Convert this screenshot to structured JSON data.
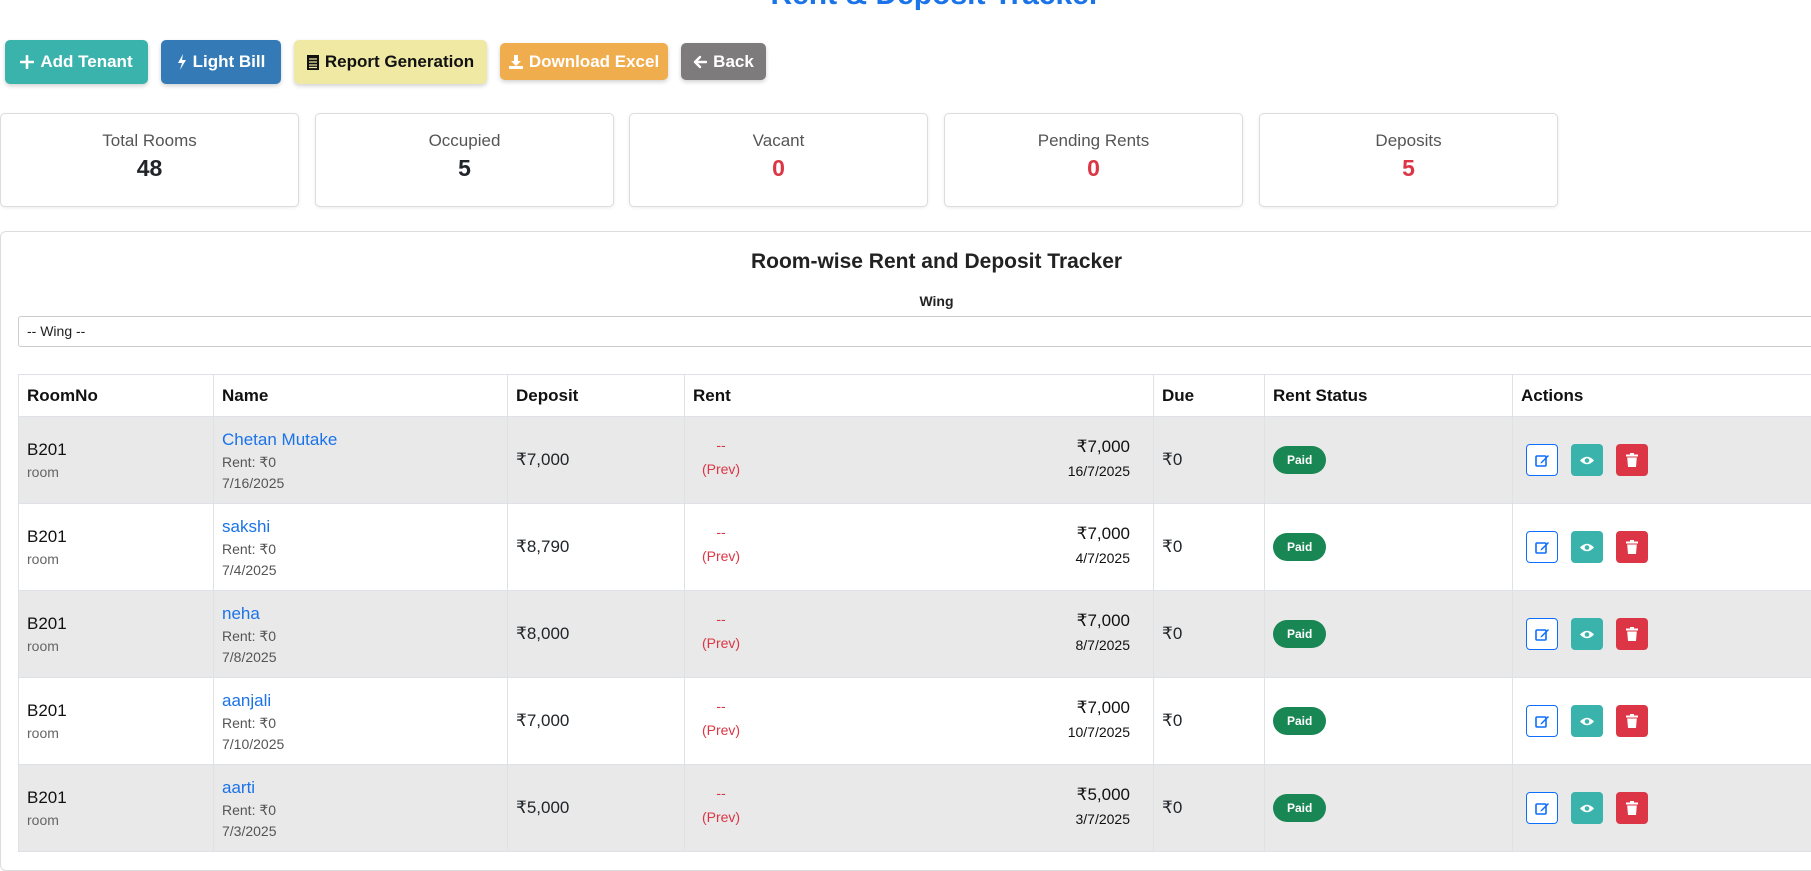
{
  "page": {
    "title": "Rent & Deposit Tracker"
  },
  "toolbar": {
    "add_tenant": "Add Tenant",
    "light_bill": "Light Bill",
    "report_generation": "Report Generation",
    "download_excel": "Download Excel",
    "back": "Back"
  },
  "stats": {
    "total_rooms": {
      "label": "Total Rooms",
      "value": "48"
    },
    "occupied": {
      "label": "Occupied",
      "value": "5"
    },
    "vacant": {
      "label": "Vacant",
      "value": "0"
    },
    "pending_rents": {
      "label": "Pending Rents",
      "value": "0"
    },
    "deposits": {
      "label": "Deposits",
      "value": "5"
    }
  },
  "tracker": {
    "title": "Room-wise Rent and Deposit Tracker",
    "wing_label": "Wing",
    "wing_selected": "-- Wing --",
    "columns": [
      "RoomNo",
      "Name",
      "Deposit",
      "Rent",
      "Due",
      "Rent Status",
      "Actions"
    ],
    "rows": [
      {
        "room": "B201",
        "room_type": "room",
        "name": "Chetan Mutake",
        "rent_line": "Rent: ₹0",
        "date": "7/16/2025",
        "deposit": "₹7,000",
        "prev_dash": "--",
        "prev_label": "(Prev)",
        "rent_amount": "₹7,000",
        "rent_date": "16/7/2025",
        "due": "₹0",
        "status": "Paid"
      },
      {
        "room": "B201",
        "room_type": "room",
        "name": "sakshi",
        "rent_line": "Rent: ₹0",
        "date": "7/4/2025",
        "deposit": "₹8,790",
        "prev_dash": "--",
        "prev_label": "(Prev)",
        "rent_amount": "₹7,000",
        "rent_date": "4/7/2025",
        "due": "₹0",
        "status": "Paid"
      },
      {
        "room": "B201",
        "room_type": "room",
        "name": "neha",
        "rent_line": "Rent: ₹0",
        "date": "7/8/2025",
        "deposit": "₹8,000",
        "prev_dash": "--",
        "prev_label": "(Prev)",
        "rent_amount": "₹7,000",
        "rent_date": "8/7/2025",
        "due": "₹0",
        "status": "Paid"
      },
      {
        "room": "B201",
        "room_type": "room",
        "name": "aanjali",
        "rent_line": "Rent: ₹0",
        "date": "7/10/2025",
        "deposit": "₹7,000",
        "prev_dash": "--",
        "prev_label": "(Prev)",
        "rent_amount": "₹7,000",
        "rent_date": "10/7/2025",
        "due": "₹0",
        "status": "Paid"
      },
      {
        "room": "B201",
        "room_type": "room",
        "name": "aarti",
        "rent_line": "Rent: ₹0",
        "date": "7/3/2025",
        "deposit": "₹5,000",
        "prev_dash": "--",
        "prev_label": "(Prev)",
        "rent_amount": "₹5,000",
        "rent_date": "3/7/2025",
        "due": "₹0",
        "status": "Paid"
      }
    ]
  },
  "icons": {
    "add": "plus-icon",
    "light_bill": "bolt-icon",
    "report": "document-icon",
    "excel": "download-icon",
    "back": "arrow-left-icon",
    "edit": "edit-icon",
    "view": "eye-icon",
    "delete": "trash-icon"
  },
  "colors": {
    "primary": "#1a73e8",
    "teal": "#3bb3ad",
    "blue": "#337ab7",
    "yellow": "#efe9a4",
    "orange": "#f0ad4e",
    "gray": "#7d7b7b",
    "danger": "#dc3545",
    "success": "#198754"
  }
}
